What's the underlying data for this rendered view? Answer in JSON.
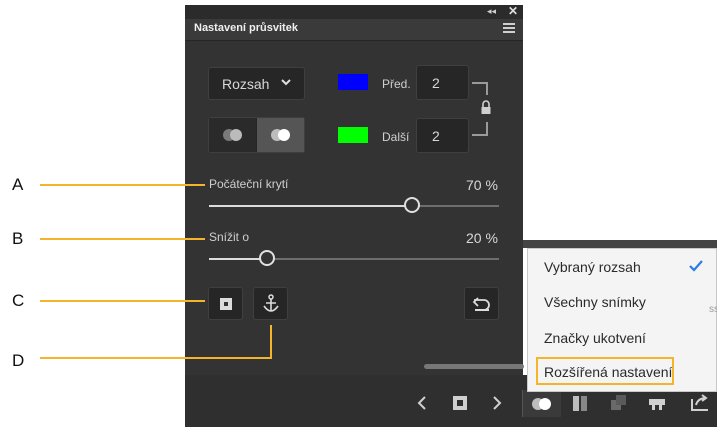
{
  "panel": {
    "title": "Nastavení průsvitek",
    "range_dropdown": {
      "label": "Rozsah"
    },
    "previous": {
      "label": "Před.",
      "value": "2",
      "color": "#0000ff"
    },
    "next": {
      "label": "Další",
      "value": "2",
      "color": "#00ff00"
    },
    "sliders": [
      {
        "label": "Počáteční krytí",
        "value": "70",
        "unit": "%",
        "fraction": 0.7
      },
      {
        "label": "Snížit o",
        "value": "20",
        "unit": "%",
        "fraction": 0.2
      }
    ]
  },
  "callouts": {
    "a": "A",
    "b": "B",
    "c": "C",
    "d": "D"
  },
  "menu": {
    "items": [
      "Vybraný rozsah",
      "Všechny snímky",
      "Značky ukotvení",
      "Rozšířená nastavení"
    ],
    "checked_index": 0,
    "highlighted_index": 3
  },
  "colors": {
    "accent": "#f5b52a",
    "check": "#2c7be5"
  }
}
